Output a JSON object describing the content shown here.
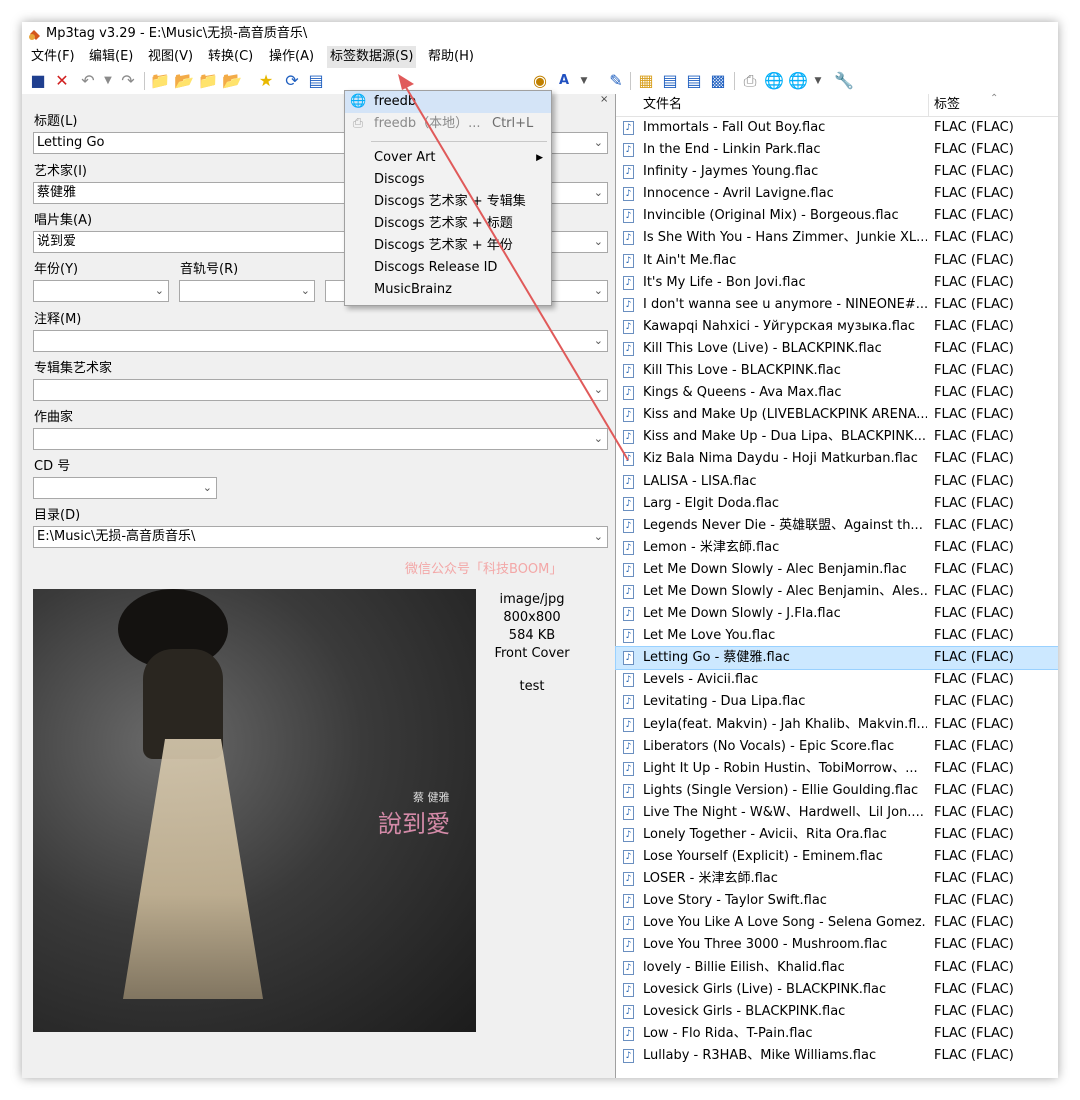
{
  "window": {
    "title": "Mp3tag v3.29  -  E:\\Music\\无损-高音质音乐\\"
  },
  "menu": [
    "文件(F)",
    "编辑(E)",
    "视图(V)",
    "转换(C)",
    "操作(A)",
    "标签数据源(S)",
    "帮助(H)"
  ],
  "fields": {
    "title": {
      "label": "标题(L)",
      "value": "Letting Go"
    },
    "artist": {
      "label": "艺术家(I)",
      "value": "蔡健雅"
    },
    "album": {
      "label": "唱片集(A)",
      "value": "说到爱"
    },
    "year": {
      "label": "年份(Y)",
      "value": ""
    },
    "track": {
      "label": "音轨号(R)",
      "value": ""
    },
    "comment": {
      "label": "注释(M)",
      "value": ""
    },
    "album_artist": {
      "label": "专辑集艺术家",
      "value": ""
    },
    "composer": {
      "label": "作曲家",
      "value": ""
    },
    "cd": {
      "label": "CD 号",
      "value": ""
    },
    "directory": {
      "label": "目录(D)",
      "value": "E:\\Music\\无损-高音质音乐\\"
    }
  },
  "watermark": "微信公众号「科技BOOM」",
  "cover": {
    "artist": "蔡 健雅",
    "title": "說到愛"
  },
  "image_info": {
    "format": "image/jpg",
    "dimensions": "800x800",
    "size": "584 KB",
    "type": "Front Cover",
    "description": "test"
  },
  "dropdown": {
    "items": [
      {
        "label": "freedb",
        "shortcut": "",
        "disabled": false
      },
      {
        "label": "freedb（本地）...",
        "shortcut": "Ctrl+L",
        "disabled": true
      },
      {
        "label": "Cover Art",
        "shortcut": "",
        "disabled": false
      },
      {
        "label": "Discogs",
        "shortcut": "",
        "disabled": false
      },
      {
        "label": "Discogs 艺术家 + 专辑集",
        "shortcut": "",
        "disabled": false
      },
      {
        "label": "Discogs 艺术家 + 标题",
        "shortcut": "",
        "disabled": false
      },
      {
        "label": "Discogs 艺术家 + 年份",
        "shortcut": "",
        "disabled": false
      },
      {
        "label": "Discogs Release ID",
        "shortcut": "",
        "disabled": false
      },
      {
        "label": "MusicBrainz",
        "shortcut": "",
        "disabled": false
      }
    ]
  },
  "file_list": {
    "headers": {
      "filename": "文件名",
      "tag": "标签"
    },
    "rows": [
      {
        "name": "Immortals - Fall Out Boy.flac",
        "tag": "FLAC (FLAC)"
      },
      {
        "name": "In the End - Linkin Park.flac",
        "tag": "FLAC (FLAC)"
      },
      {
        "name": "Infinity - Jaymes Young.flac",
        "tag": "FLAC (FLAC)"
      },
      {
        "name": "Innocence - Avril Lavigne.flac",
        "tag": "FLAC (FLAC)"
      },
      {
        "name": "Invincible (Original Mix) - Borgeous.flac",
        "tag": "FLAC (FLAC)"
      },
      {
        "name": "Is She With You - Hans Zimmer、Junkie XL....",
        "tag": "FLAC (FLAC)"
      },
      {
        "name": "It Ain't Me.flac",
        "tag": "FLAC (FLAC)"
      },
      {
        "name": "It's My Life - Bon Jovi.flac",
        "tag": "FLAC (FLAC)"
      },
      {
        "name": "I don't wanna see u anymore - NINEONE#...",
        "tag": "FLAC (FLAC)"
      },
      {
        "name": "Kawapqi Nahxici - Уйгурская музыка.flac",
        "tag": "FLAC (FLAC)"
      },
      {
        "name": "Kill This Love (Live) - BLACKPINK.flac",
        "tag": "FLAC (FLAC)"
      },
      {
        "name": "Kill This Love - BLACKPINK.flac",
        "tag": "FLAC (FLAC)"
      },
      {
        "name": "Kings & Queens - Ava Max.flac",
        "tag": "FLAC (FLAC)"
      },
      {
        "name": "Kiss and Make Up (LIVEBLACKPINK ARENA...",
        "tag": "FLAC (FLAC)"
      },
      {
        "name": "Kiss and Make Up - Dua Lipa、BLACKPINK....",
        "tag": "FLAC (FLAC)"
      },
      {
        "name": "Kiz Bala Nima Daydu - Hoji Matkurban.flac",
        "tag": "FLAC (FLAC)"
      },
      {
        "name": "LALISA - LISA.flac",
        "tag": "FLAC (FLAC)"
      },
      {
        "name": "Larg - Elgit Doda.flac",
        "tag": "FLAC (FLAC)"
      },
      {
        "name": "Legends Never Die - 英雄联盟、Against th...",
        "tag": "FLAC (FLAC)"
      },
      {
        "name": "Lemon - 米津玄師.flac",
        "tag": "FLAC (FLAC)"
      },
      {
        "name": "Let Me Down Slowly - Alec Benjamin.flac",
        "tag": "FLAC (FLAC)"
      },
      {
        "name": "Let Me Down Slowly - Alec Benjamin、Ales...",
        "tag": "FLAC (FLAC)"
      },
      {
        "name": "Let Me Down Slowly - J.Fla.flac",
        "tag": "FLAC (FLAC)"
      },
      {
        "name": "Let Me Love You.flac",
        "tag": "FLAC (FLAC)"
      },
      {
        "name": "Letting Go - 蔡健雅.flac",
        "tag": "FLAC (FLAC)",
        "selected": true
      },
      {
        "name": "Levels - Avicii.flac",
        "tag": "FLAC (FLAC)"
      },
      {
        "name": "Levitating - Dua Lipa.flac",
        "tag": "FLAC (FLAC)"
      },
      {
        "name": "Leyla(feat. Makvin) - Jah Khalib、Makvin.fl...",
        "tag": "FLAC (FLAC)"
      },
      {
        "name": "Liberators (No Vocals) - Epic Score.flac",
        "tag": "FLAC (FLAC)"
      },
      {
        "name": "Light It Up - Robin Hustin、TobiMorrow、...",
        "tag": "FLAC (FLAC)"
      },
      {
        "name": "Lights (Single Version) - Ellie Goulding.flac",
        "tag": "FLAC (FLAC)"
      },
      {
        "name": "Live The Night - W&W、Hardwell、Lil Jon....",
        "tag": "FLAC (FLAC)"
      },
      {
        "name": "Lonely Together - Avicii、Rita Ora.flac",
        "tag": "FLAC (FLAC)"
      },
      {
        "name": "Lose Yourself (Explicit) - Eminem.flac",
        "tag": "FLAC (FLAC)"
      },
      {
        "name": "LOSER - 米津玄師.flac",
        "tag": "FLAC (FLAC)"
      },
      {
        "name": "Love Story - Taylor Swift.flac",
        "tag": "FLAC (FLAC)"
      },
      {
        "name": "Love You Like A Love Song - Selena Gomez...",
        "tag": "FLAC (FLAC)"
      },
      {
        "name": "Love You Three 3000 - Mushroom.flac",
        "tag": "FLAC (FLAC)"
      },
      {
        "name": "lovely - Billie Eilish、Khalid.flac",
        "tag": "FLAC (FLAC)"
      },
      {
        "name": "Lovesick Girls (Live) - BLACKPINK.flac",
        "tag": "FLAC (FLAC)"
      },
      {
        "name": "Lovesick Girls - BLACKPINK.flac",
        "tag": "FLAC (FLAC)"
      },
      {
        "name": "Low - Flo Rida、T-Pain.flac",
        "tag": "FLAC (FLAC)"
      },
      {
        "name": "Lullaby - R3HAB、Mike Williams.flac",
        "tag": "FLAC (FLAC)"
      }
    ]
  },
  "colors": {
    "accent": "#e05a5a",
    "selection": "#cce8ff",
    "menu_hover": "#d4e4f7"
  }
}
